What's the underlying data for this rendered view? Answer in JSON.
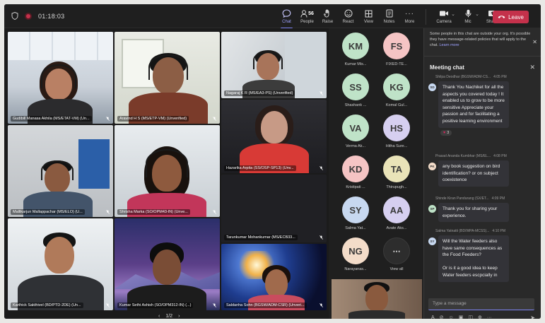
{
  "timer": "01:18:03",
  "toolbar": {
    "chat": "Chat",
    "people": "People",
    "people_count": "56",
    "raise": "Raise",
    "react": "React",
    "view": "View",
    "notes": "Notes",
    "more": "More",
    "camera": "Camera",
    "mic": "Mic",
    "share": "Share",
    "leave": "Leave"
  },
  "tiles": [
    {
      "name": "Gudibill Manasa Akhila (MS/ETAT-VM) (Un..."
    },
    {
      "name": "Aravind H S (MS/ETP-VM) (Unverified)"
    },
    {
      "name": "Nagaraj K R (MS/EA3-PS) (Unverified)"
    },
    {
      "name": "Mallikarjun Mallappachar (MS/ELO) (U..."
    },
    {
      "name": "Shrisha Marka (SO/OPM43-IN) (Unve..."
    },
    {
      "name": "Hazarika Arpita (SS/OSP-SP13) (Unv..."
    },
    {
      "name": "Tarunkumar Mohankumar (MS/ECB33..."
    },
    {
      "name": "Karthick Sakthivel (BD/PTD-2DE) (Un..."
    },
    {
      "name": "Kumar Sethi Ashish (SO/OPM312-IN) (...)"
    },
    {
      "name": "Saldanha Sohn (BGSW/ADM-CSR) (Unveri..."
    }
  ],
  "pager": {
    "text": "1/2"
  },
  "avatars": [
    {
      "initials": "KM",
      "name": "Kumar Mis...",
      "color": "#bfe3c8"
    },
    {
      "initials": "FS",
      "name": "FIXED-TE...",
      "color": "#f5c4c4"
    },
    {
      "initials": "SS",
      "name": "Shashank ...",
      "color": "#bfe3c8"
    },
    {
      "initials": "KG",
      "name": "Komal Gul...",
      "color": "#bfe3c8"
    },
    {
      "initials": "VA",
      "name": "Verma Ak...",
      "color": "#bfe3c8"
    },
    {
      "initials": "HS",
      "name": "Hitha Sure...",
      "color": "#d6cff0"
    },
    {
      "initials": "KD",
      "name": "Kristipati ...",
      "color": "#f5c4c4"
    },
    {
      "initials": "TA",
      "name": "Thirupugh...",
      "color": "#e9e3b8"
    },
    {
      "initials": "SY",
      "name": "Salma Yat...",
      "color": "#c7d8f0"
    },
    {
      "initials": "AA",
      "name": "Avate Aks...",
      "color": "#d6cff0"
    },
    {
      "initials": "NG",
      "name": "Narayanas...",
      "color": "#f3dcc9"
    },
    {
      "initials": "⋯",
      "name": "View all",
      "color": "#2d2d2d"
    }
  ],
  "chat": {
    "notice": "Some people in this chat are outside your org. It's possible they have message-related policies that will apply to the chat.",
    "learn_more": "Learn more",
    "title": "Meeting chat",
    "messages": [
      {
        "sender": "Shilpa Deodhar (BGSW/ADM-CS...",
        "time": "4:05 PM",
        "initials": "SD",
        "color": "#c7d8f0",
        "text": "Thank You Nachiket for all the aspects you covered today ! It enabled us to grow to be more sensitive Appreciate your passion and for facilitating a positive learning environment",
        "reaction": "3"
      },
      {
        "sender": "Prasad Ananda Kumbhar (MS/EL...",
        "time": "4:08 PM",
        "initials": "PK",
        "color": "#f3dcc9",
        "text": "any book suggestion on bird identification? or on subject coexistence"
      },
      {
        "sender": "Shinde Kiran Pandurang (SX/ET...",
        "time": "4:09 PM",
        "initials": "SP",
        "color": "#bfe3c8",
        "text": "Thank you for sharing your experience."
      },
      {
        "sender": "Salma Yatnatti (BD/WPA-MCSS)...",
        "time": "4:10 PM",
        "initials": "SY",
        "color": "#c7d8f0",
        "text": "Will the Water feeders also have same consequences as the Food Feeders?\n\nOr is it a good idea to keep Water feeders escpcially in"
      }
    ],
    "compose_placeholder": "Type a message"
  }
}
